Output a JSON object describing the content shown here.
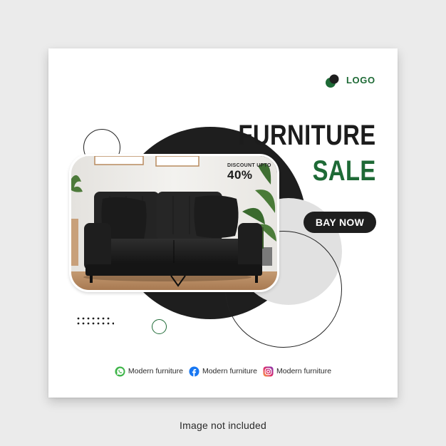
{
  "logo": {
    "text": "LOGO",
    "icon": "logo-circles-icon"
  },
  "headline": {
    "line1": "FURNITURE",
    "line2": "SALE"
  },
  "discount": {
    "label": "DISCOUNT UPTO",
    "value": "40%"
  },
  "cta": {
    "label": "BAY NOW"
  },
  "socials": [
    {
      "icon": "whatsapp-icon",
      "label": "Modern furniture"
    },
    {
      "icon": "facebook-icon",
      "label": "Modern furniture"
    },
    {
      "icon": "instagram-icon",
      "label": "Modern furniture"
    }
  ],
  "footer_note": "Image not included",
  "colors": {
    "accent_green": "#1e6a36",
    "dark": "#1e1e1e",
    "light_gray": "#e1e1e1",
    "background": "#ebebeb",
    "card": "#ffffff"
  }
}
